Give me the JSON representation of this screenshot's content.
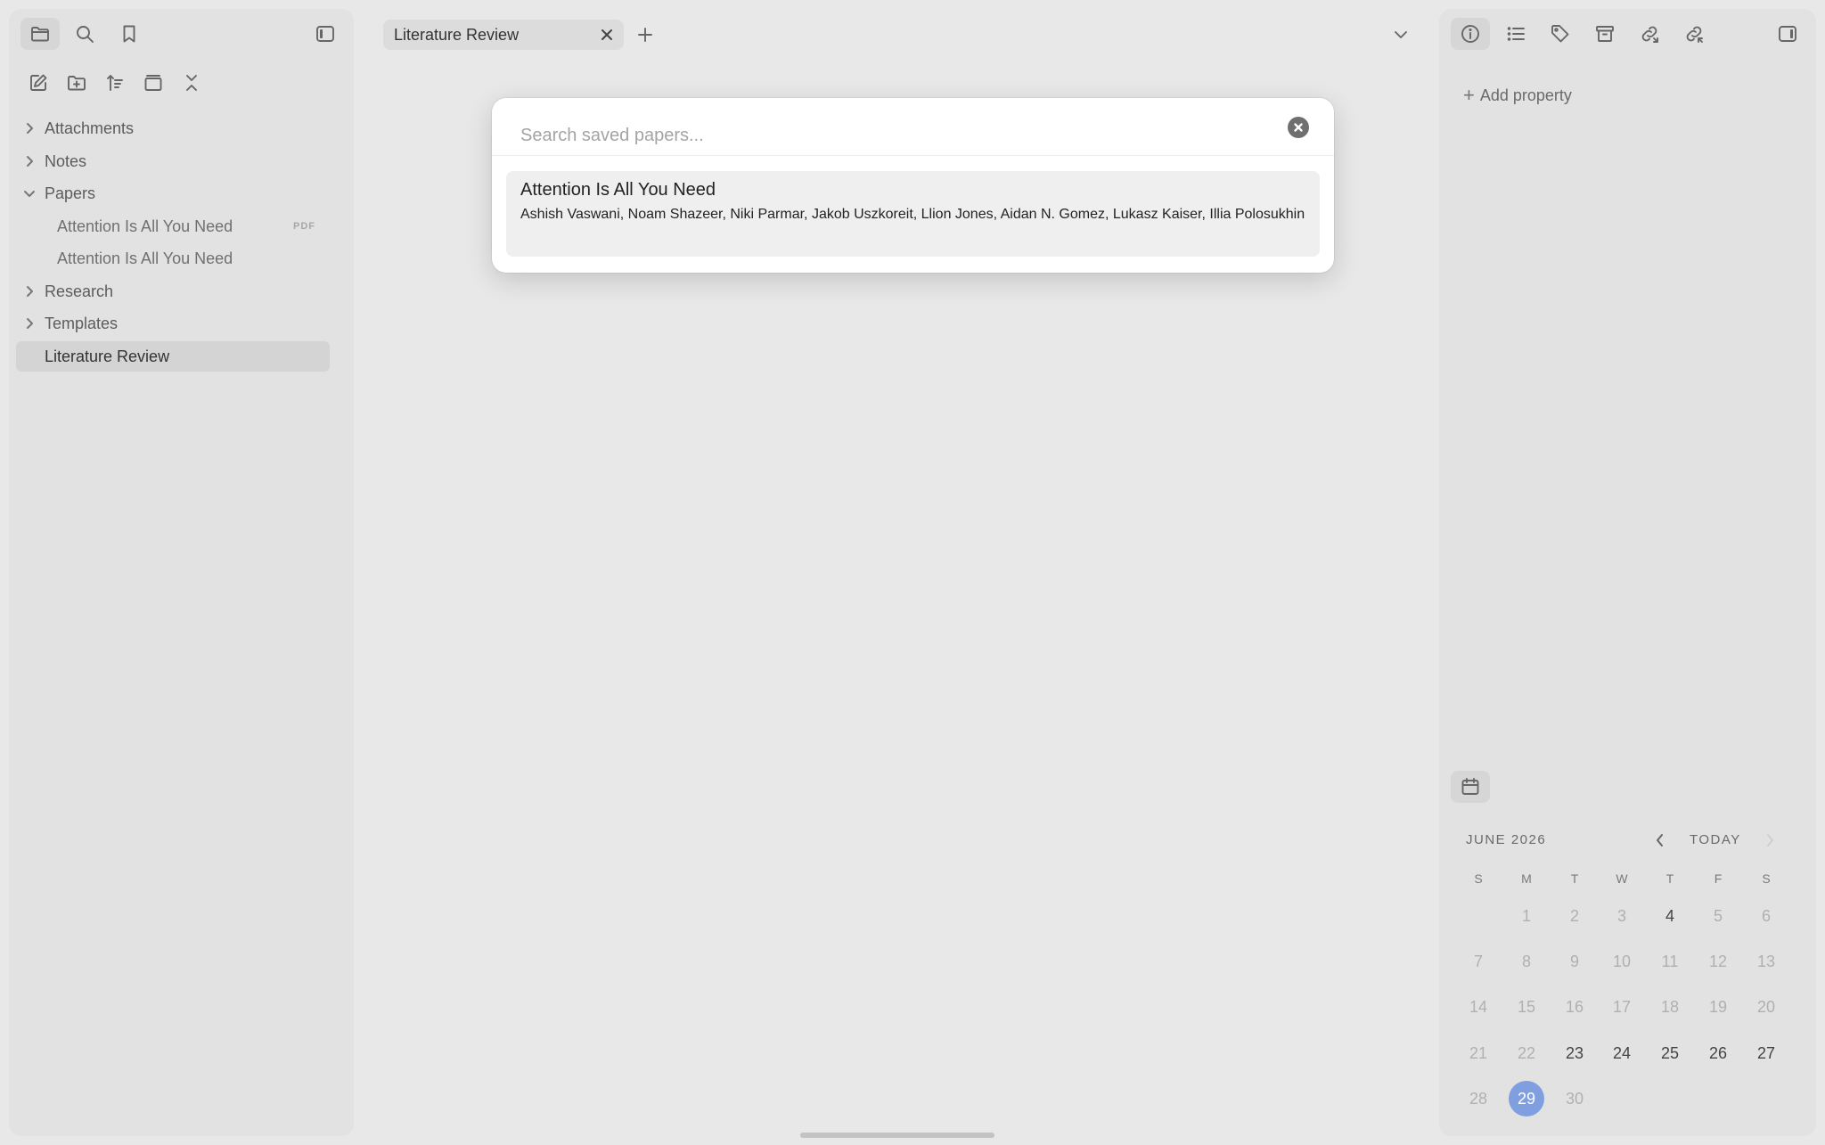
{
  "left_sidebar": {
    "tree": [
      {
        "label": "Attachments",
        "expanded": false
      },
      {
        "label": "Notes",
        "expanded": false
      },
      {
        "label": "Papers",
        "expanded": true
      },
      {
        "label": "Attention Is All You Need",
        "badge": "PDF"
      },
      {
        "label": "Attention Is All You Need"
      },
      {
        "label": "Research",
        "expanded": false
      },
      {
        "label": "Templates",
        "expanded": false
      },
      {
        "label": "Literature Review",
        "selected": true
      }
    ],
    "icons": [
      "folder-icon",
      "search-icon",
      "bookmark-icon",
      "sidebar-toggle-icon",
      "new-note-icon",
      "new-folder-icon",
      "sort-icon",
      "collapse-view-icon",
      "collapse-all-icon"
    ]
  },
  "tabs": [
    {
      "label": "Literature Review",
      "active": true
    }
  ],
  "modal": {
    "search_placeholder": "Search saved papers...",
    "search_value": "",
    "results": [
      {
        "title": "Attention Is All You Need",
        "authors": "Ashish Vaswani, Noam Shazeer, Niki Parmar, Jakob Uszkoreit, Llion Jones, Aidan N. Gomez, Lukasz Kaiser, Illia Polosukhin"
      }
    ]
  },
  "right_panel": {
    "icons": [
      "info-icon",
      "outline-icon",
      "tag-icon",
      "archive-icon",
      "outgoing-links-icon",
      "backlinks-icon",
      "right-sidebar-toggle-icon",
      "calendar-icon"
    ],
    "add_property_label": "Add property"
  },
  "calendar": {
    "month_label": "JUNE 2026",
    "today_label": "TODAY",
    "weekdays": [
      "S",
      "M",
      "T",
      "W",
      "T",
      "F",
      "S"
    ],
    "weeks": [
      [
        "",
        "1",
        "2",
        "3",
        "4",
        "5",
        "6"
      ],
      [
        "7",
        "8",
        "9",
        "10",
        "11",
        "12",
        "13"
      ],
      [
        "14",
        "15",
        "16",
        "17",
        "18",
        "19",
        "20"
      ],
      [
        "21",
        "22",
        "23",
        "24",
        "25",
        "26",
        "27"
      ],
      [
        "28",
        "29",
        "30",
        "",
        "",
        "",
        ""
      ]
    ],
    "days_with_notes": [
      "4",
      "23",
      "24",
      "25",
      "26",
      "27"
    ],
    "selected_day": "29",
    "accent_color": "#7f9fe0"
  }
}
